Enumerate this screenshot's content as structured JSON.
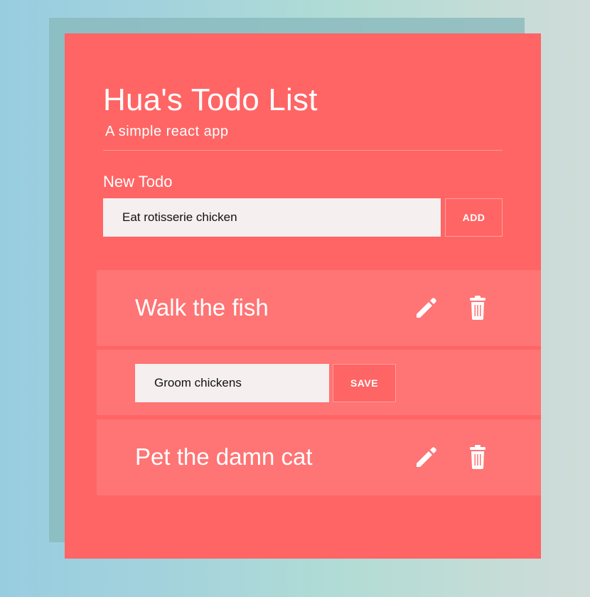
{
  "header": {
    "title": "Hua's Todo List",
    "subtitle": "A simple react app"
  },
  "new_todo": {
    "label": "New Todo",
    "input_value": "Eat rotisserie chicken",
    "add_label": "ADD"
  },
  "todos": [
    {
      "text": "Walk the fish",
      "mode": "view",
      "edit_icon": "pencil-icon",
      "delete_icon": "trash-icon"
    },
    {
      "edit_value": "Groom chickens",
      "mode": "edit",
      "save_label": "SAVE"
    },
    {
      "text": "Pet the damn cat",
      "mode": "view",
      "edit_icon": "pencil-icon",
      "delete_icon": "trash-icon"
    }
  ],
  "colors": {
    "primary": "#ff6565",
    "todo_row": "#ff7474",
    "input_background": "#f6efef",
    "text": "#ffffff",
    "input_text": "#111111"
  }
}
